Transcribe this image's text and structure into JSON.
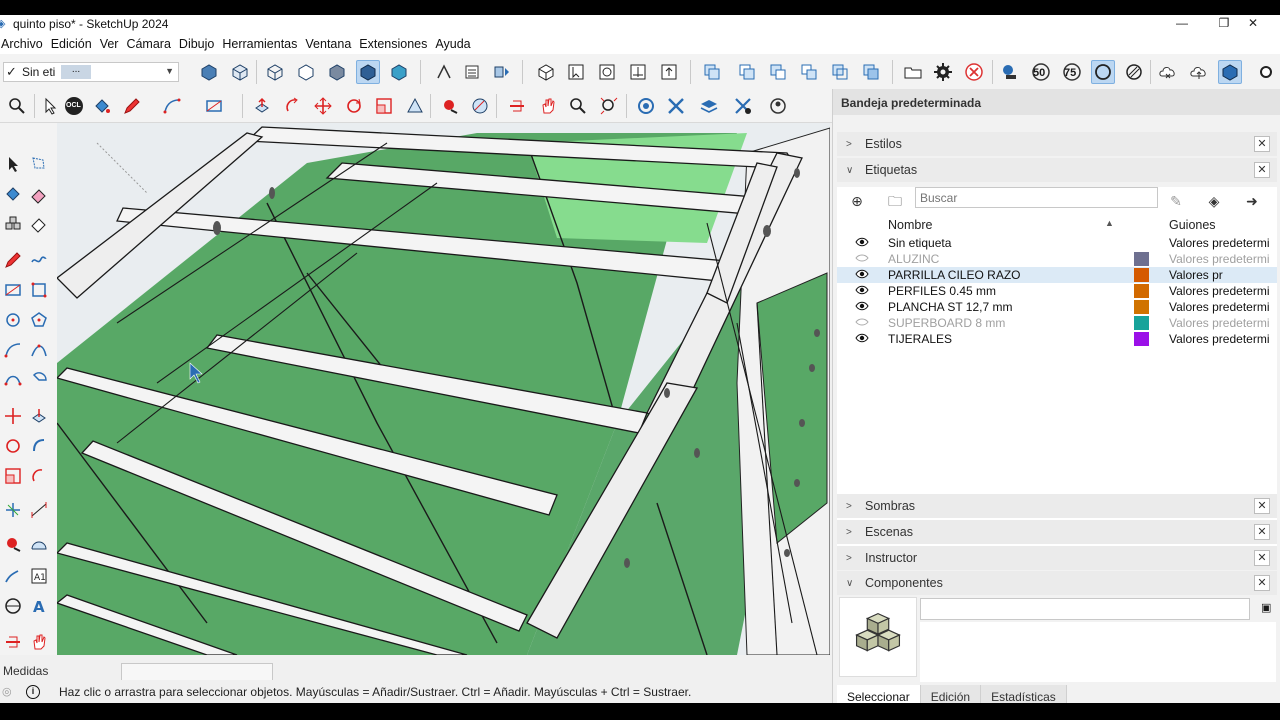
{
  "window": {
    "title": "quinto piso* - SketchUp 2024",
    "minimize": "—",
    "restore": "❐",
    "close": "✕"
  },
  "menu": [
    "Archivo",
    "Edición",
    "Ver",
    "Cámara",
    "Dibujo",
    "Herramientas",
    "Ventana",
    "Extensiones",
    "Ayuda"
  ],
  "toolbar": {
    "tag_select_value": "Sin eti",
    "tag_select_overflow": "...",
    "ocl_badge": "OCL",
    "badge_50": "50",
    "badge_75": "75"
  },
  "measurements": {
    "label": "Medidas",
    "value": ""
  },
  "status": {
    "hint": "Haz clic o arrastra para seleccionar objetos. Mayúsculas = Añadir/Sustraer. Ctrl = Añadir. Mayúsculas + Ctrl = Sustraer."
  },
  "tray": {
    "title": "Bandeja predeterminada",
    "panels": {
      "estilos": "Estilos",
      "etiquetas": "Etiquetas",
      "sombras": "Sombras",
      "escenas": "Escenas",
      "instructor": "Instructor",
      "componentes": "Componentes"
    },
    "tags": {
      "search_placeholder": "Buscar",
      "col_name": "Nombre",
      "col_dashes": "Guiones",
      "rows": [
        {
          "name": "Sin etiqueta",
          "dashes": "Valores predetermi",
          "visible": true,
          "color": ""
        },
        {
          "name": "ALUZINC",
          "dashes": "Valores predetermi",
          "visible": false,
          "color": "#6e7090"
        },
        {
          "name": "PARRILLA  CILEO RAZO",
          "dashes": "Valores pr",
          "visible": true,
          "color": "#d55a00"
        },
        {
          "name": "PERFILES 0.45 mm",
          "dashes": "Valores predetermi",
          "visible": true,
          "color": "#d26a00"
        },
        {
          "name": "PLANCHA  ST 12,7 mm",
          "dashes": "Valores predetermi",
          "visible": true,
          "color": "#d07300"
        },
        {
          "name": "SUPERBOARD 8 mm",
          "dashes": "Valores predetermi",
          "visible": false,
          "color": "#17a39a"
        },
        {
          "name": "TIJERALES",
          "dashes": "Valores predetermi",
          "visible": true,
          "color": "#9b10e8"
        }
      ]
    },
    "component_tabs": [
      "Seleccionar",
      "Edición",
      "Estadísticas"
    ]
  },
  "colors": {
    "accent": "#2a6cb3",
    "board_green": "#58a866",
    "selected_row": "#dceaf6"
  }
}
